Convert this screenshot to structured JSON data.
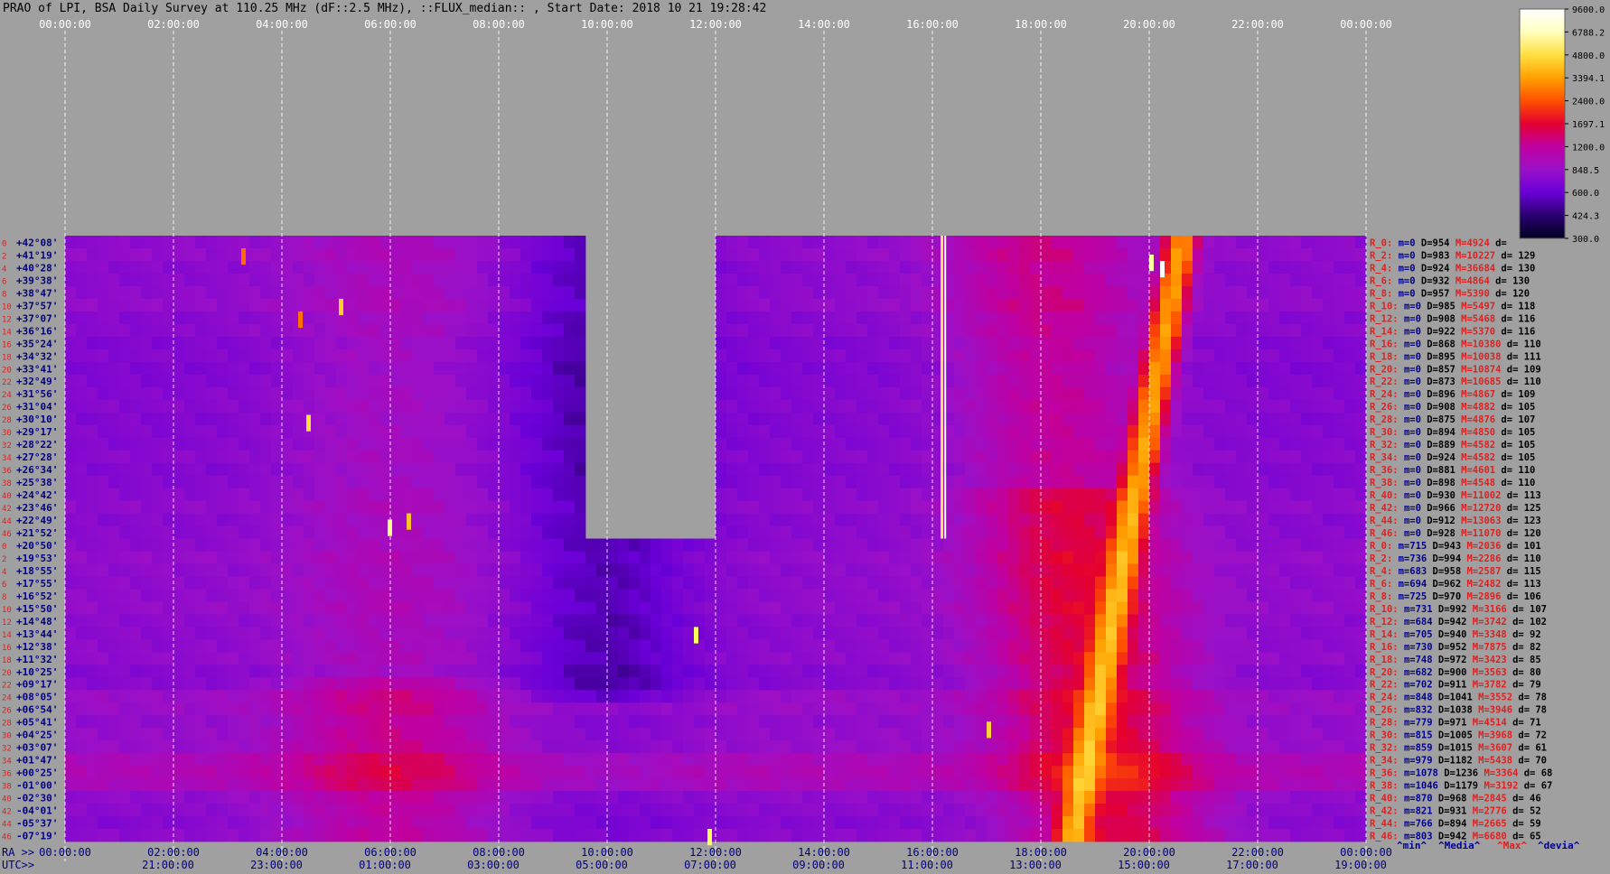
{
  "title": "PRAO of LPI, BSA Daily Survey at 110.25 MHz (dF::2.5 MHz), ::FLUX_median:: , Start Date: 2018 10 21 19:28:42",
  "top_axis": {
    "ticks": [
      "00:00:00",
      "02:00:00",
      "04:00:00",
      "06:00:00",
      "08:00:00",
      "10:00:00",
      "12:00:00",
      "14:00:00",
      "16:00:00",
      "18:00:00",
      "20:00:00",
      "22:00:00",
      "00:00:00"
    ]
  },
  "ra_axis": {
    "label": "RA >>",
    "ticks": [
      "00:00:00",
      "02:00:00",
      "04:00:00",
      "06:00:00",
      "08:00:00",
      "10:00:00",
      "12:00:00",
      "14:00:00",
      "16:00:00",
      "18:00:00",
      "20:00:00",
      "22:00:00",
      "00:00:00"
    ]
  },
  "utc_axis": {
    "label": "UTC>>",
    "ticks": [
      "21:00:00",
      "23:00:00",
      "01:00:00",
      "03:00:00",
      "05:00:00",
      "07:00:00",
      "09:00:00",
      "11:00:00",
      "13:00:00",
      "15:00:00",
      "17:00:00",
      "19:00:00"
    ]
  },
  "colorbar": {
    "ticks": [
      "9600.0",
      "6788.2",
      "4800.0",
      "3394.1",
      "2400.0",
      "1697.1",
      "1200.0",
      "848.5",
      "600.0",
      "424.3",
      "300.0"
    ],
    "colors": [
      "#000020",
      "#2a0070",
      "#6a00d8",
      "#9a10c8",
      "#c000a0",
      "#e40030",
      "#ff5000",
      "#ffa000",
      "#ffe040",
      "#ffffc0",
      "#ffffff"
    ]
  },
  "footer": {
    "min": "^min^",
    "median": "^Media^",
    "max": "^Max^",
    "dev": "^devia^"
  },
  "chart_data": {
    "type": "heatmap",
    "x_axis": "RA (hours)",
    "xlim": [
      0,
      24
    ],
    "color_scale": "log",
    "clim": [
      300.0,
      9600.0
    ],
    "rows": [
      {
        "idx": "0",
        "dec": "+42°08'",
        "band": "R_0:",
        "m": "0",
        "D": "954",
        "M": "4924",
        "d": ""
      },
      {
        "idx": "2",
        "dec": "+41°19'",
        "band": "R_2:",
        "m": "0",
        "D": "983",
        "M": "10227",
        "d": "129"
      },
      {
        "idx": "4",
        "dec": "+40°28'",
        "band": "R_4:",
        "m": "0",
        "D": "924",
        "M": "36684",
        "d": "130"
      },
      {
        "idx": "6",
        "dec": "+39°38'",
        "band": "R_6:",
        "m": "0",
        "D": "932",
        "M": "4864",
        "d": "130"
      },
      {
        "idx": "8",
        "dec": "+38°47'",
        "band": "R_8:",
        "m": "0",
        "D": "957",
        "M": "5390",
        "d": "120"
      },
      {
        "idx": "10",
        "dec": "+37°57'",
        "band": "R_10:",
        "m": "0",
        "D": "985",
        "M": "5497",
        "d": "118"
      },
      {
        "idx": "12",
        "dec": "+37°07'",
        "band": "R_12:",
        "m": "0",
        "D": "908",
        "M": "5468",
        "d": "116"
      },
      {
        "idx": "14",
        "dec": "+36°16'",
        "band": "R_14:",
        "m": "0",
        "D": "922",
        "M": "5370",
        "d": "116"
      },
      {
        "idx": "16",
        "dec": "+35°24'",
        "band": "R_16:",
        "m": "0",
        "D": "868",
        "M": "10380",
        "d": "110"
      },
      {
        "idx": "18",
        "dec": "+34°32'",
        "band": "R_18:",
        "m": "0",
        "D": "895",
        "M": "10038",
        "d": "111"
      },
      {
        "idx": "20",
        "dec": "+33°41'",
        "band": "R_20:",
        "m": "0",
        "D": "857",
        "M": "10874",
        "d": "109"
      },
      {
        "idx": "22",
        "dec": "+32°49'",
        "band": "R_22:",
        "m": "0",
        "D": "873",
        "M": "10685",
        "d": "110"
      },
      {
        "idx": "24",
        "dec": "+31°56'",
        "band": "R_24:",
        "m": "0",
        "D": "896",
        "M": "4867",
        "d": "109"
      },
      {
        "idx": "26",
        "dec": "+31°04'",
        "band": "R_26:",
        "m": "0",
        "D": "908",
        "M": "4882",
        "d": "105"
      },
      {
        "idx": "28",
        "dec": "+30°10'",
        "band": "R_28:",
        "m": "0",
        "D": "875",
        "M": "4876",
        "d": "107"
      },
      {
        "idx": "30",
        "dec": "+29°17'",
        "band": "R_30:",
        "m": "0",
        "D": "894",
        "M": "4850",
        "d": "105"
      },
      {
        "idx": "32",
        "dec": "+28°22'",
        "band": "R_32:",
        "m": "0",
        "D": "889",
        "M": "4582",
        "d": "105"
      },
      {
        "idx": "34",
        "dec": "+27°28'",
        "band": "R_34:",
        "m": "0",
        "D": "924",
        "M": "4582",
        "d": "105"
      },
      {
        "idx": "36",
        "dec": "+26°34'",
        "band": "R_36:",
        "m": "0",
        "D": "881",
        "M": "4601",
        "d": "110"
      },
      {
        "idx": "38",
        "dec": "+25°38'",
        "band": "R_38:",
        "m": "0",
        "D": "898",
        "M": "4548",
        "d": "110"
      },
      {
        "idx": "40",
        "dec": "+24°42'",
        "band": "R_40:",
        "m": "0",
        "D": "930",
        "M": "11002",
        "d": "113"
      },
      {
        "idx": "42",
        "dec": "+23°46'",
        "band": "R_42:",
        "m": "0",
        "D": "966",
        "M": "12720",
        "d": "125"
      },
      {
        "idx": "44",
        "dec": "+22°49'",
        "band": "R_44:",
        "m": "0",
        "D": "912",
        "M": "13063",
        "d": "123"
      },
      {
        "idx": "46",
        "dec": "+21°52'",
        "band": "R_46:",
        "m": "0",
        "D": "928",
        "M": "11070",
        "d": "120"
      },
      {
        "idx": "0",
        "dec": "+20°50'",
        "band": "R_0:",
        "m": "715",
        "D": "943",
        "M": "2036",
        "d": "101"
      },
      {
        "idx": "2",
        "dec": "+19°53'",
        "band": "R_2:",
        "m": "736",
        "D": "994",
        "M": "2286",
        "d": "110"
      },
      {
        "idx": "4",
        "dec": "+18°55'",
        "band": "R_4:",
        "m": "683",
        "D": "958",
        "M": "2587",
        "d": "115"
      },
      {
        "idx": "6",
        "dec": "+17°55'",
        "band": "R_6:",
        "m": "694",
        "D": "962",
        "M": "2482",
        "d": "113"
      },
      {
        "idx": "8",
        "dec": "+16°52'",
        "band": "R_8:",
        "m": "725",
        "D": "970",
        "M": "2896",
        "d": "106"
      },
      {
        "idx": "10",
        "dec": "+15°50'",
        "band": "R_10:",
        "m": "731",
        "D": "992",
        "M": "3166",
        "d": "107"
      },
      {
        "idx": "12",
        "dec": "+14°48'",
        "band": "R_12:",
        "m": "684",
        "D": "942",
        "M": "3742",
        "d": "102"
      },
      {
        "idx": "14",
        "dec": "+13°44'",
        "band": "R_14:",
        "m": "705",
        "D": "940",
        "M": "3348",
        "d": "92"
      },
      {
        "idx": "16",
        "dec": "+12°38'",
        "band": "R_16:",
        "m": "730",
        "D": "952",
        "M": "7875",
        "d": "82"
      },
      {
        "idx": "18",
        "dec": "+11°32'",
        "band": "R_18:",
        "m": "748",
        "D": "972",
        "M": "3423",
        "d": "85"
      },
      {
        "idx": "20",
        "dec": "+10°25'",
        "band": "R_20:",
        "m": "682",
        "D": "900",
        "M": "3563",
        "d": "80"
      },
      {
        "idx": "22",
        "dec": "+09°17'",
        "band": "R_22:",
        "m": "702",
        "D": "911",
        "M": "3782",
        "d": "79"
      },
      {
        "idx": "24",
        "dec": "+08°05'",
        "band": "R_24:",
        "m": "848",
        "D": "1041",
        "M": "3552",
        "d": "78"
      },
      {
        "idx": "26",
        "dec": "+06°54'",
        "band": "R_26:",
        "m": "832",
        "D": "1038",
        "M": "3946",
        "d": "78"
      },
      {
        "idx": "28",
        "dec": "+05°41'",
        "band": "R_28:",
        "m": "779",
        "D": "971",
        "M": "4514",
        "d": "71"
      },
      {
        "idx": "30",
        "dec": "+04°25'",
        "band": "R_30:",
        "m": "815",
        "D": "1005",
        "M": "3968",
        "d": "72"
      },
      {
        "idx": "32",
        "dec": "+03°07'",
        "band": "R_32:",
        "m": "859",
        "D": "1015",
        "M": "3607",
        "d": "61"
      },
      {
        "idx": "34",
        "dec": "+01°47'",
        "band": "R_34:",
        "m": "979",
        "D": "1182",
        "M": "5438",
        "d": "70"
      },
      {
        "idx": "36",
        "dec": "+00°25'",
        "band": "R_36:",
        "m": "1078",
        "D": "1236",
        "M": "3364",
        "d": "68"
      },
      {
        "idx": "38",
        "dec": "-01°00'",
        "band": "R_38:",
        "m": "1046",
        "D": "1179",
        "M": "3192",
        "d": "67"
      },
      {
        "idx": "40",
        "dec": "-02°30'",
        "band": "R_40:",
        "m": "870",
        "D": "968",
        "M": "2845",
        "d": "46"
      },
      {
        "idx": "42",
        "dec": "-04°01'",
        "band": "R_42:",
        "m": "821",
        "D": "931",
        "M": "2776",
        "d": "52"
      },
      {
        "idx": "44",
        "dec": "-05°37'",
        "band": "R_44:",
        "m": "766",
        "D": "894",
        "M": "2665",
        "d": "59"
      },
      {
        "idx": "46",
        "dec": "-07°19'",
        "band": "R_46:",
        "m": "803",
        "D": "942",
        "M": "6680",
        "d": "65"
      }
    ],
    "gaps": [
      {
        "ra_from": 9.55,
        "ra_to": 12.0,
        "row_from": 0,
        "row_to": 23
      },
      {
        "ra_from": 0,
        "ra_to": 24,
        "row_from": -1,
        "row_to": -1,
        "note_sky": "above_all_rows"
      }
    ],
    "source_tracks": [
      {
        "desc": "bright drift",
        "ra_start": 20.6,
        "row_start": 0,
        "ra_end": 18.6,
        "row_end": 47
      }
    ]
  }
}
